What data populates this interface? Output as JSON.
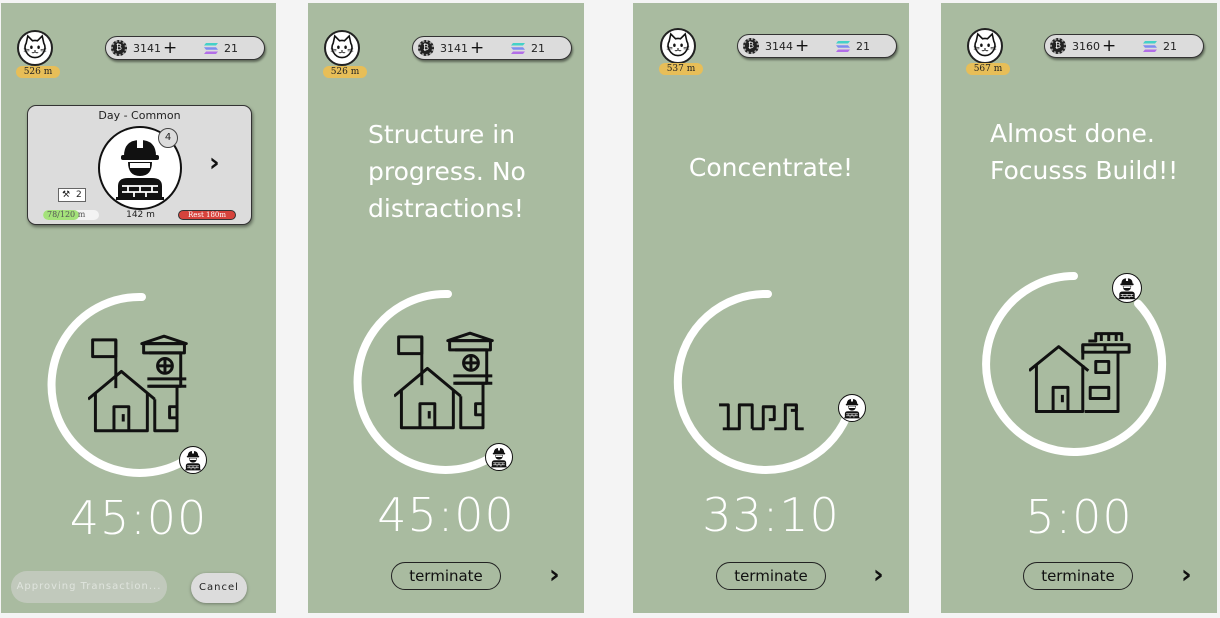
{
  "screens": [
    {
      "distance": "526 m",
      "coins": "3141",
      "gems": "21",
      "card": {
        "title": "Day - Common",
        "level": "4",
        "tool_count": "2",
        "progress_text": "78/120 m",
        "progress_fraction": 0.65,
        "distance": "142 m",
        "rest": "Rest 180m"
      },
      "timer": "45:00",
      "approve_label": "Approving Transaction...",
      "cancel_label": "Cancel"
    },
    {
      "distance": "526 m",
      "coins": "3141",
      "gems": "21",
      "message": [
        "Structure in",
        "progress. No",
        "distractions!"
      ],
      "timer": "45:00",
      "terminate_label": "terminate"
    },
    {
      "distance": "537 m",
      "coins": "3144",
      "gems": "21",
      "message": [
        "Concentrate!"
      ],
      "timer": "33:10",
      "terminate_label": "terminate"
    },
    {
      "distance": "567 m",
      "coins": "3160",
      "gems": "21",
      "message": [
        "Almost done.",
        "Focusss Build!!"
      ],
      "timer": "5:00",
      "terminate_label": "terminate"
    }
  ],
  "colors": {
    "screen_bg": "#a9bba0",
    "badge": "#e7be58",
    "progress": "#a4e27a",
    "rest": "#d6433c"
  },
  "icons": [
    "cat-avatar-icon",
    "coin-icon",
    "plus-icon",
    "sol-gem-icon",
    "worker-icon",
    "hammer-icon",
    "house-icon",
    "chevron-right-icon"
  ]
}
